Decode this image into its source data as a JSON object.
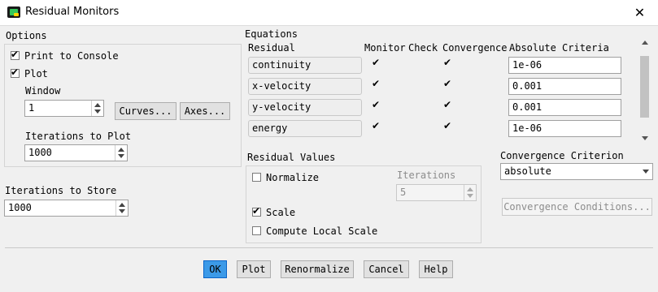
{
  "window": {
    "title": "Residual Monitors",
    "close_glyph": "✕"
  },
  "options": {
    "heading": "Options",
    "print_to_console": {
      "label": "Print to Console",
      "checked": true
    },
    "plot": {
      "label": "Plot",
      "checked": true
    },
    "window_label": "Window",
    "window_value": "1",
    "curves_button": "Curves...",
    "axes_button": "Axes...",
    "iterations_to_plot_label": "Iterations to Plot",
    "iterations_to_plot_value": "1000"
  },
  "store": {
    "label": "Iterations to Store",
    "value": "1000"
  },
  "equations": {
    "heading": "Equations",
    "columns": {
      "residual": "Residual",
      "monitor": "Monitor",
      "check": "Check",
      "convergence": "Convergence",
      "criteria": "Absolute Criteria"
    },
    "rows": [
      {
        "name": "continuity",
        "monitor": true,
        "convergence": true,
        "criteria": "1e-06"
      },
      {
        "name": "x-velocity",
        "monitor": true,
        "convergence": true,
        "criteria": "0.001"
      },
      {
        "name": "y-velocity",
        "monitor": true,
        "convergence": true,
        "criteria": "0.001"
      },
      {
        "name": "energy",
        "monitor": true,
        "convergence": true,
        "criteria": "1e-06"
      }
    ]
  },
  "residual_values": {
    "heading": "Residual Values",
    "normalize": {
      "label": "Normalize",
      "checked": false
    },
    "iterations_label": "Iterations",
    "iterations_value": "5",
    "scale": {
      "label": "Scale",
      "checked": true
    },
    "compute_local_scale": {
      "label": "Compute Local Scale",
      "checked": false
    }
  },
  "convergence": {
    "heading": "Convergence Criterion",
    "selected": "absolute",
    "conditions_button": "Convergence Conditions..."
  },
  "buttons": {
    "ok": "OK",
    "plot": "Plot",
    "renormalize": "Renormalize",
    "cancel": "Cancel",
    "help": "Help"
  },
  "colors": {
    "accent": "#0078d7",
    "ok_fill": "#3c9ae8"
  }
}
